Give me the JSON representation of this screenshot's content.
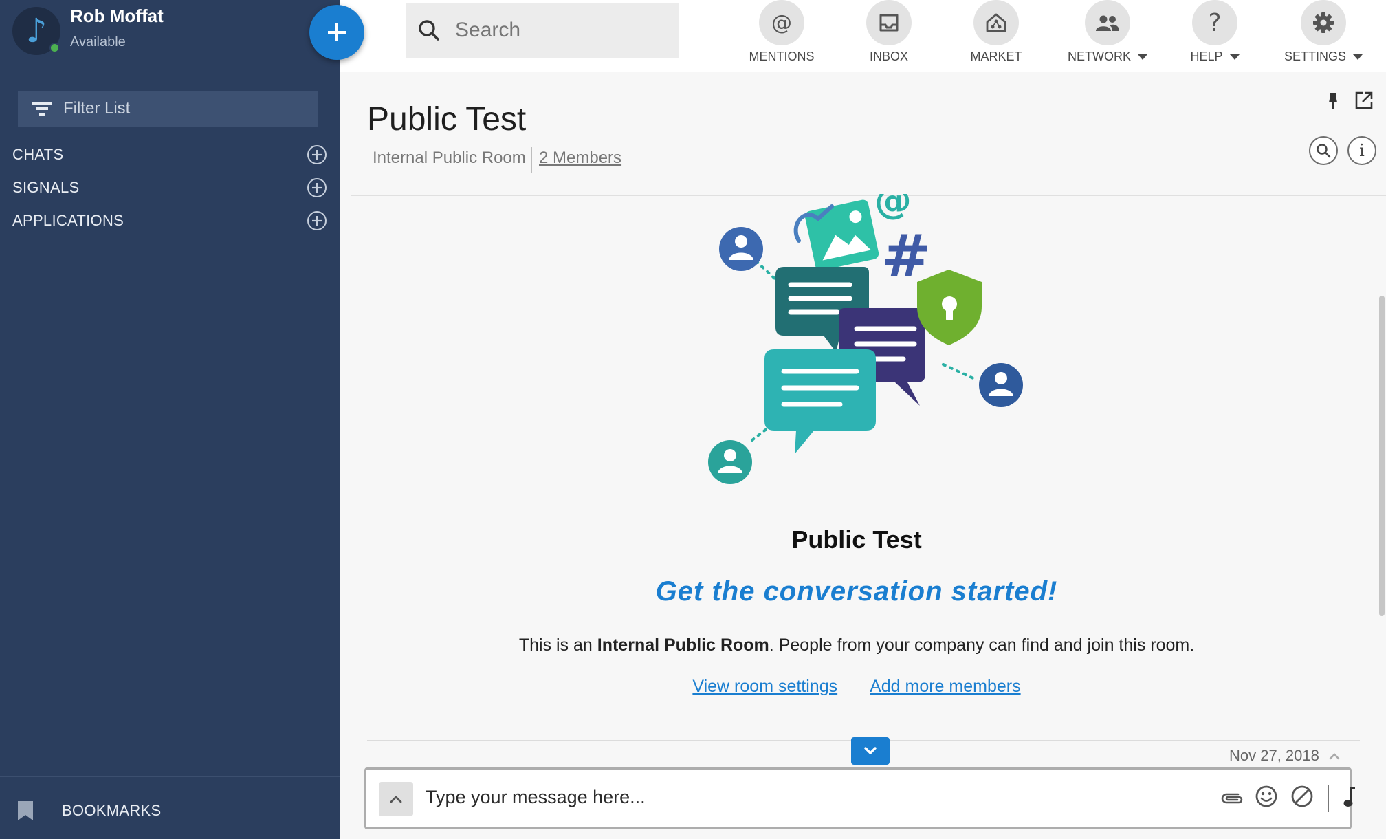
{
  "user": {
    "name": "Rob Moffat",
    "status": "Available"
  },
  "sidebar": {
    "filter_label": "Filter List",
    "sections": [
      {
        "label": "CHATS"
      },
      {
        "label": "SIGNALS"
      },
      {
        "label": "APPLICATIONS"
      }
    ],
    "bookmarks_label": "BOOKMARKS"
  },
  "search": {
    "placeholder": "Search"
  },
  "nav": [
    {
      "label": "MENTIONS",
      "icon": "at-icon"
    },
    {
      "label": "INBOX",
      "icon": "inbox-icon"
    },
    {
      "label": "MARKET",
      "icon": "market-icon"
    },
    {
      "label": "NETWORK",
      "icon": "network-icon"
    },
    {
      "label": "HELP",
      "icon": "help-icon"
    },
    {
      "label": "SETTINGS",
      "icon": "gear-icon"
    }
  ],
  "room": {
    "title": "Public Test",
    "type": "Internal Public Room",
    "members": "2 Members"
  },
  "welcome": {
    "title": "Public Test",
    "cta": "Get the conversation started!",
    "desc_prefix": "This is an ",
    "desc_bold": "Internal Public Room",
    "desc_suffix": ". People from your company can find and join this room.",
    "link_settings": "View room settings",
    "link_members": "Add more members"
  },
  "timeline": {
    "date": "Nov 27, 2018"
  },
  "composer": {
    "placeholder": "Type your message here..."
  },
  "colors": {
    "sidebar_bg": "#2b3e5e",
    "accent": "#1a7ed0",
    "presence": "#4cb050"
  }
}
